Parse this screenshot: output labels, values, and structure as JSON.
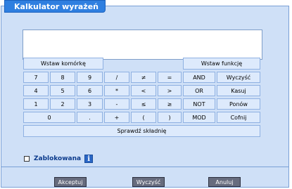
{
  "title": "Kalkulator wyrażeń",
  "buttons": {
    "insert_cell": "Wstaw komórkę",
    "insert_function": "Wstaw funkcję",
    "row1": [
      "7",
      "8",
      "9",
      "/",
      "≠",
      "=",
      "AND",
      "Wyczyść"
    ],
    "row2": [
      "4",
      "5",
      "6",
      "*",
      "<",
      ">",
      "OR",
      "Kasuj"
    ],
    "row3": [
      "1",
      "2",
      "3",
      "-",
      "≤",
      "≥",
      "NOT",
      "Ponów"
    ],
    "row4": [
      "0",
      ".",
      "+",
      "(",
      ")",
      "MOD",
      "Cofnij"
    ],
    "check_syntax": "Sprawdź składnię"
  },
  "locked_label": "Zablokowana",
  "info_icon_glyph": "i",
  "footer": {
    "accept": "Akceptuj",
    "clear": "Wyczyść",
    "cancel": "Anuluj"
  }
}
